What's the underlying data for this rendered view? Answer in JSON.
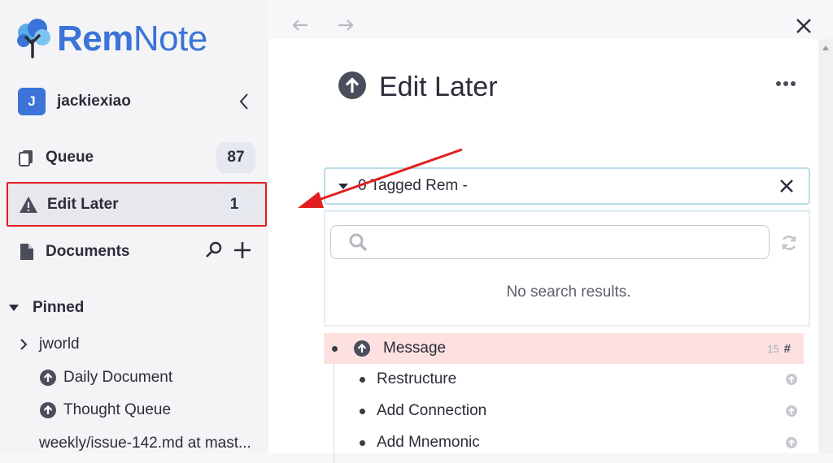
{
  "logo": {
    "brand_bold": "Rem",
    "brand_light": "Note"
  },
  "user": {
    "initial": "J",
    "name": "jackiexiao"
  },
  "nav": {
    "queue": {
      "label": "Queue",
      "count": "87"
    },
    "edit_later": {
      "label": "Edit Later",
      "count": "1"
    },
    "documents": {
      "label": "Documents"
    }
  },
  "pinned": {
    "title": "Pinned",
    "items": [
      {
        "label": "jworld"
      },
      {
        "label": "Daily Document"
      },
      {
        "label": "Thought Queue"
      },
      {
        "label": "weekly/issue-142.md at mast..."
      }
    ]
  },
  "page": {
    "title": "Edit Later"
  },
  "tag_filter": {
    "label": "0 Tagged Rem -"
  },
  "search": {
    "placeholder": "",
    "no_results": "No search results."
  },
  "rems": [
    {
      "text": "Message",
      "count": "15",
      "hash": "#"
    },
    {
      "text": "Restructure"
    },
    {
      "text": "Add Connection"
    },
    {
      "text": "Add Mnemonic"
    }
  ],
  "icons": {
    "logo": "tree-icon",
    "queue": "cards-icon",
    "edit_later": "warning-icon",
    "documents": "document-icon",
    "back": "arrow-left-icon",
    "forward": "arrow-right-icon",
    "close": "close-icon",
    "edit_later_title": "arrow-up-circle-icon"
  },
  "colors": {
    "brand": "#3b73d8",
    "highlight": "#fde1e1",
    "annotation": "#e02020"
  }
}
